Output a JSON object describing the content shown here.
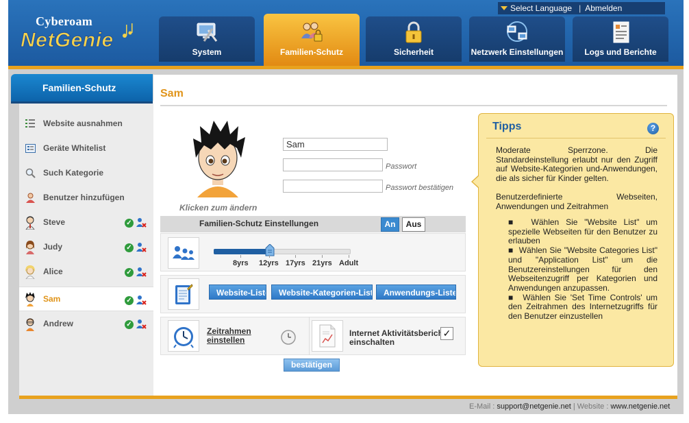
{
  "topbar": {
    "language": "Select Language",
    "logout": "Abmelden"
  },
  "logo": {
    "line1": "Cyberoam",
    "line2": "NetGenie"
  },
  "nav": [
    {
      "label": "System",
      "icon": "system-tools-icon"
    },
    {
      "label": "Familien-Schutz",
      "icon": "family-lock-icon",
      "active": true
    },
    {
      "label": "Sicherheit",
      "icon": "padlock-icon"
    },
    {
      "label": "Netzwerk Einstellungen",
      "icon": "network-icon"
    },
    {
      "label": "Logs und Berichte",
      "icon": "report-icon"
    }
  ],
  "sidebar": {
    "title": "Familien-Schutz",
    "items": [
      {
        "label": "Website ausnahmen",
        "icon": "list-icon"
      },
      {
        "label": "Geräte Whitelist",
        "icon": "device-list-icon"
      },
      {
        "label": "Such Kategorie",
        "icon": "search-icon"
      },
      {
        "label": "Benutzer hinzufügen",
        "icon": "add-user-icon"
      }
    ],
    "users": [
      {
        "name": "Steve"
      },
      {
        "name": "Judy"
      },
      {
        "name": "Alice"
      },
      {
        "name": "Sam",
        "active": true
      },
      {
        "name": "Andrew"
      }
    ]
  },
  "profile": {
    "title": "Sam",
    "avatar_caption": "Klicken zum ändern",
    "name_value": "Sam",
    "password_label": "Passwort",
    "password_confirm_label": "Passwort bestätigen"
  },
  "settings": {
    "title": "Familien-Schutz Einstellungen",
    "on_label": "An",
    "off_label": "Aus",
    "age_levels": [
      "8yrs",
      "12yrs",
      "17yrs",
      "21yrs",
      "Adult"
    ],
    "selected_age": "12yrs",
    "buttons": [
      "Website-Liste",
      "Website-Kategorien-Liste",
      "Anwendungs-Liste"
    ],
    "time_link": {
      "line1": "Zeitrahmen",
      "line2": "einstellen"
    },
    "report": {
      "line1": "Internet Aktivitätsbericht",
      "line2": "einschalten",
      "checked": true
    },
    "confirm": "bestätigen"
  },
  "tips": {
    "title": "Tipps",
    "p1": "Moderate Sperrzone. Die Standardeinstellung erlaubt nur den Zugriff auf Website-Kategorien und-Anwendungen, die als sicher für Kinder gelten.",
    "p2": "Benutzerdefinierte Webseiten, Anwendungen und Zeitrahmen",
    "bullets": [
      "Wählen Sie \"Website List\" um spezielle Webseiten für den Benutzer zu erlauben",
      "Wählen Sie \"Website Categories List\" und \"Application List\" um die Benutzereinstellungen für den Webseitenzugriff per Kategorien und Anwendungen anzupassen.",
      "Wählen Sie 'Set Time Controls' um den Zeitrahmen des Internetzugriffs für den Benutzer einzustellen"
    ]
  },
  "footer": {
    "email_label": "E-Mail :",
    "email": "support@netgenie.net",
    "sep": "|",
    "website_label": "Website :",
    "website": "www.netgenie.net"
  },
  "colors": {
    "accent": "#e0941a",
    "header_blue": "#1c5aa0",
    "tips_bg": "#fbe8a3"
  }
}
